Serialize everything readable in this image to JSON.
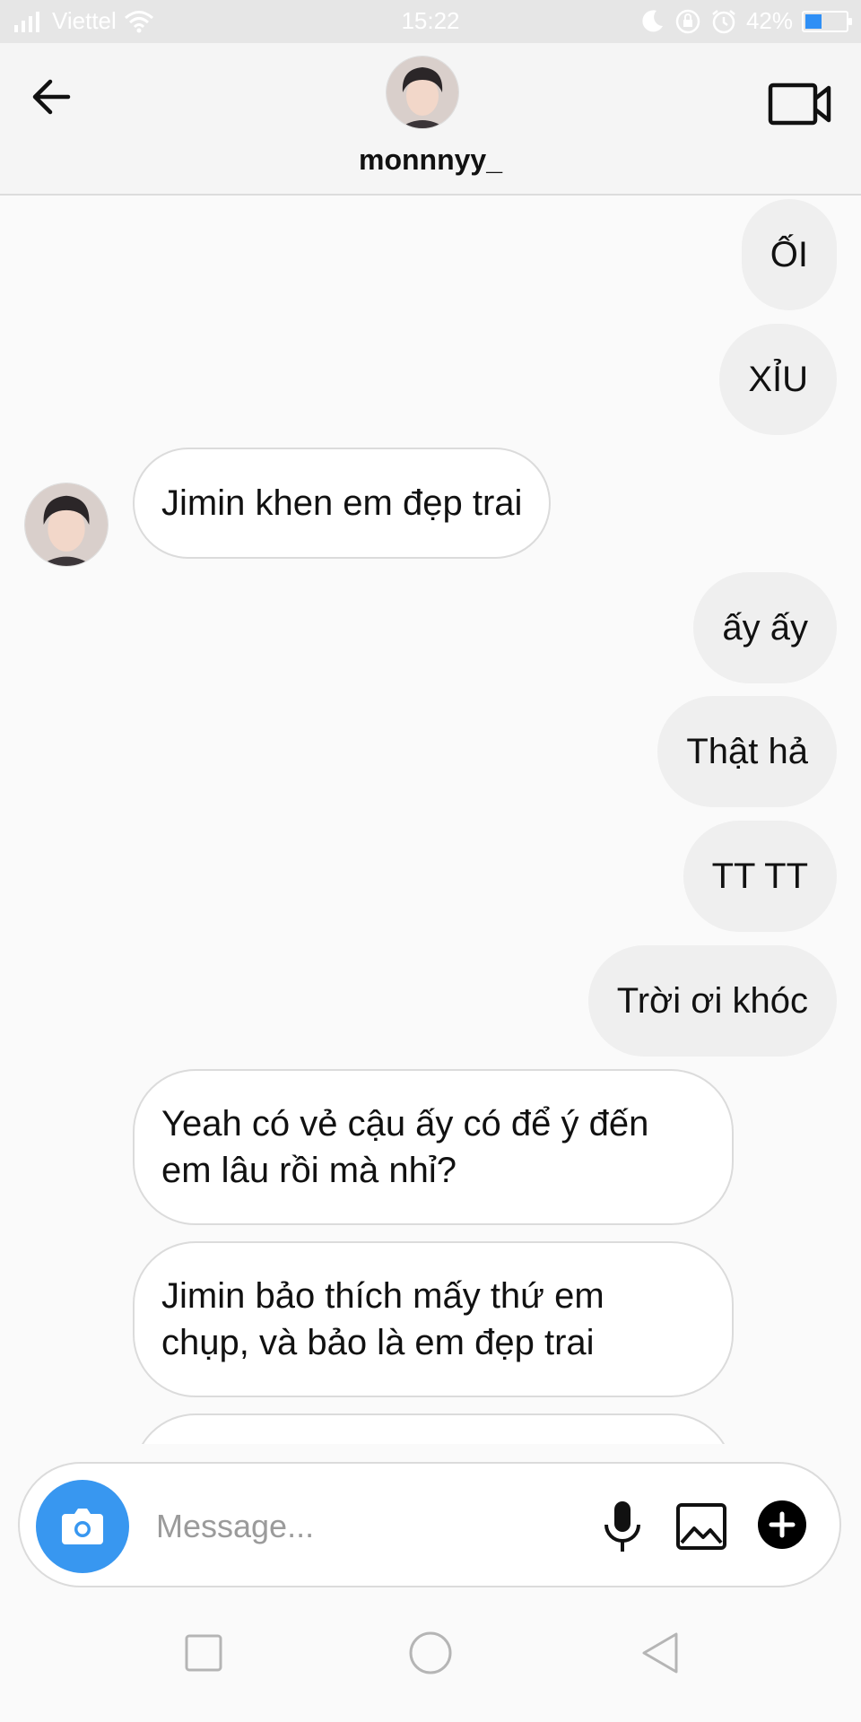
{
  "status_bar": {
    "carrier": "Viettel",
    "time": "15:22",
    "battery_percent": "42%",
    "battery_level": 0.42,
    "icons": [
      "signal-icon",
      "wifi-icon",
      "moon-icon",
      "rotation-lock-icon",
      "alarm-icon",
      "battery-icon"
    ]
  },
  "header": {
    "username": "monnnyy_",
    "back_icon": "back-arrow-icon",
    "video_icon": "video-call-icon"
  },
  "messages": [
    {
      "side": "out",
      "text": "ỐI"
    },
    {
      "side": "out",
      "text": "XỈU"
    },
    {
      "side": "in",
      "text": "Jimin khen em đẹp trai"
    },
    {
      "side": "out",
      "text": "ấy ấy"
    },
    {
      "side": "out",
      "text": "Thật hả"
    },
    {
      "side": "out",
      "text": "TT TT"
    },
    {
      "side": "out",
      "text": "Trời ơi khóc"
    },
    {
      "side": "in",
      "line1": "Yeah có vẻ cậu ấy có để ý đến",
      "line2": "em lâu rồi mà nhỉ?"
    },
    {
      "side": "in",
      "line1": "Jimin bảo thích mấy thứ em",
      "line2": "chụp, và bảo là em đẹp trai"
    }
  ],
  "composer": {
    "placeholder": "Message...",
    "icons": [
      "camera-icon",
      "microphone-icon",
      "gallery-icon",
      "plus-icon"
    ]
  },
  "colors": {
    "accent_blue": "#3897f0",
    "outgoing_bubble": "#efefef",
    "incoming_border": "#dbdbdb"
  }
}
